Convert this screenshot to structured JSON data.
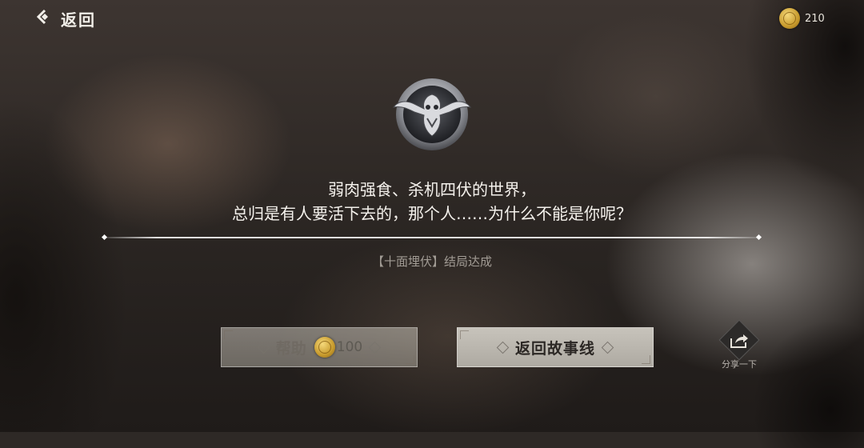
{
  "header": {
    "back_label": "返回",
    "currency_amount": "210"
  },
  "story": {
    "quote_line1": "弱肉强食、杀机四伏的世界，",
    "quote_line2": "总归是有人要活下去的，那个人……为什么不能是你呢？",
    "ending_label": "【十面埋伏】结局达成"
  },
  "buttons": {
    "help_label": "帮助",
    "help_cost": "100",
    "return_label": "返回故事线"
  },
  "share": {
    "label": "分享一下"
  },
  "icons": {
    "back": "chevron-left-icon",
    "coin": "coin-icon",
    "emblem": "insect-emblem-icon",
    "share": "share-icon"
  },
  "colors": {
    "coin_gold": "#c79a2c",
    "text_light": "#f4f1ec",
    "button_bg": "#c7c3bb"
  }
}
